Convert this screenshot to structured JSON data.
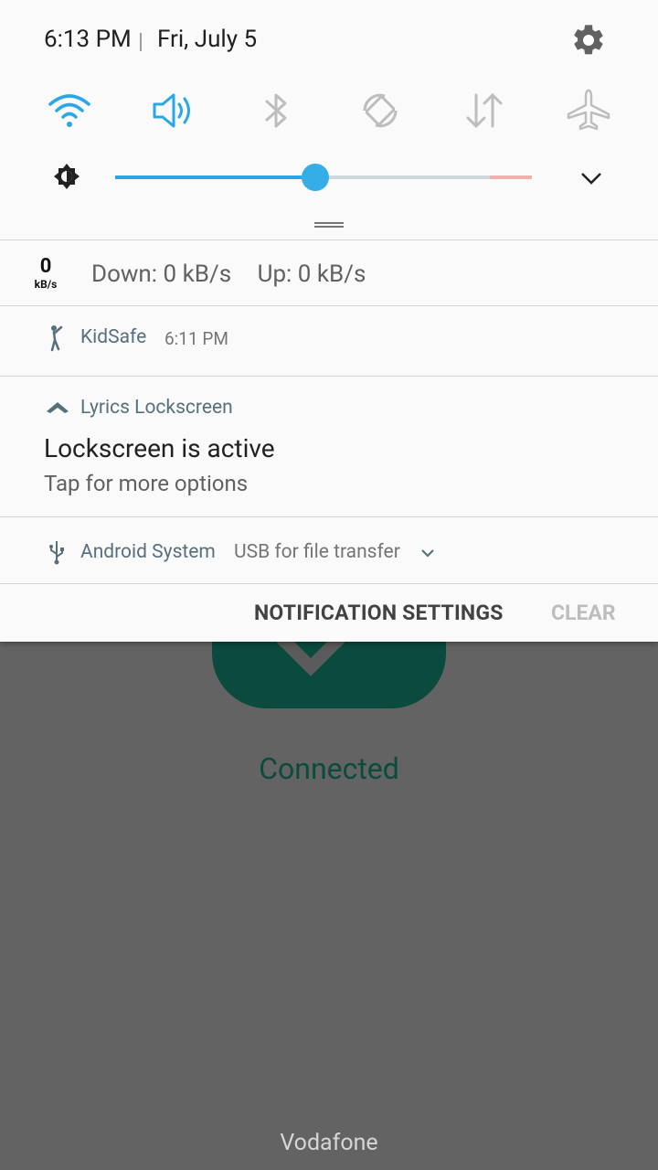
{
  "status": {
    "time": "6:13 PM",
    "date": "Fri, July 5"
  },
  "quick_settings": {
    "tiles": [
      {
        "name": "wifi-icon",
        "active": true
      },
      {
        "name": "sound-icon",
        "active": true
      },
      {
        "name": "bluetooth-icon",
        "active": false
      },
      {
        "name": "auto-rotate-icon",
        "active": false
      },
      {
        "name": "mobile-data-icon",
        "active": false
      },
      {
        "name": "airplane-mode-icon",
        "active": false
      }
    ],
    "brightness_level": 0.48,
    "colors": {
      "active": "#2aa7e6",
      "inactive": "#c7c7c7"
    }
  },
  "net_speed": {
    "badge_value": "0",
    "badge_unit": "kB/s",
    "down": "Down: 0 kB/s",
    "up": "Up: 0 kB/s"
  },
  "notifications": {
    "kidsafe": {
      "app": "KidSafe",
      "time": "6:11 PM"
    },
    "lyrics": {
      "app": "Lyrics Lockscreen",
      "title": "Lockscreen is active",
      "text": "Tap for more options"
    },
    "system": {
      "app": "Android System",
      "detail": "USB for file transfer"
    }
  },
  "actions": {
    "settings": "NOTIFICATION SETTINGS",
    "clear": "CLEAR"
  },
  "background": {
    "status": "Connected",
    "carrier": "Vodafone"
  }
}
